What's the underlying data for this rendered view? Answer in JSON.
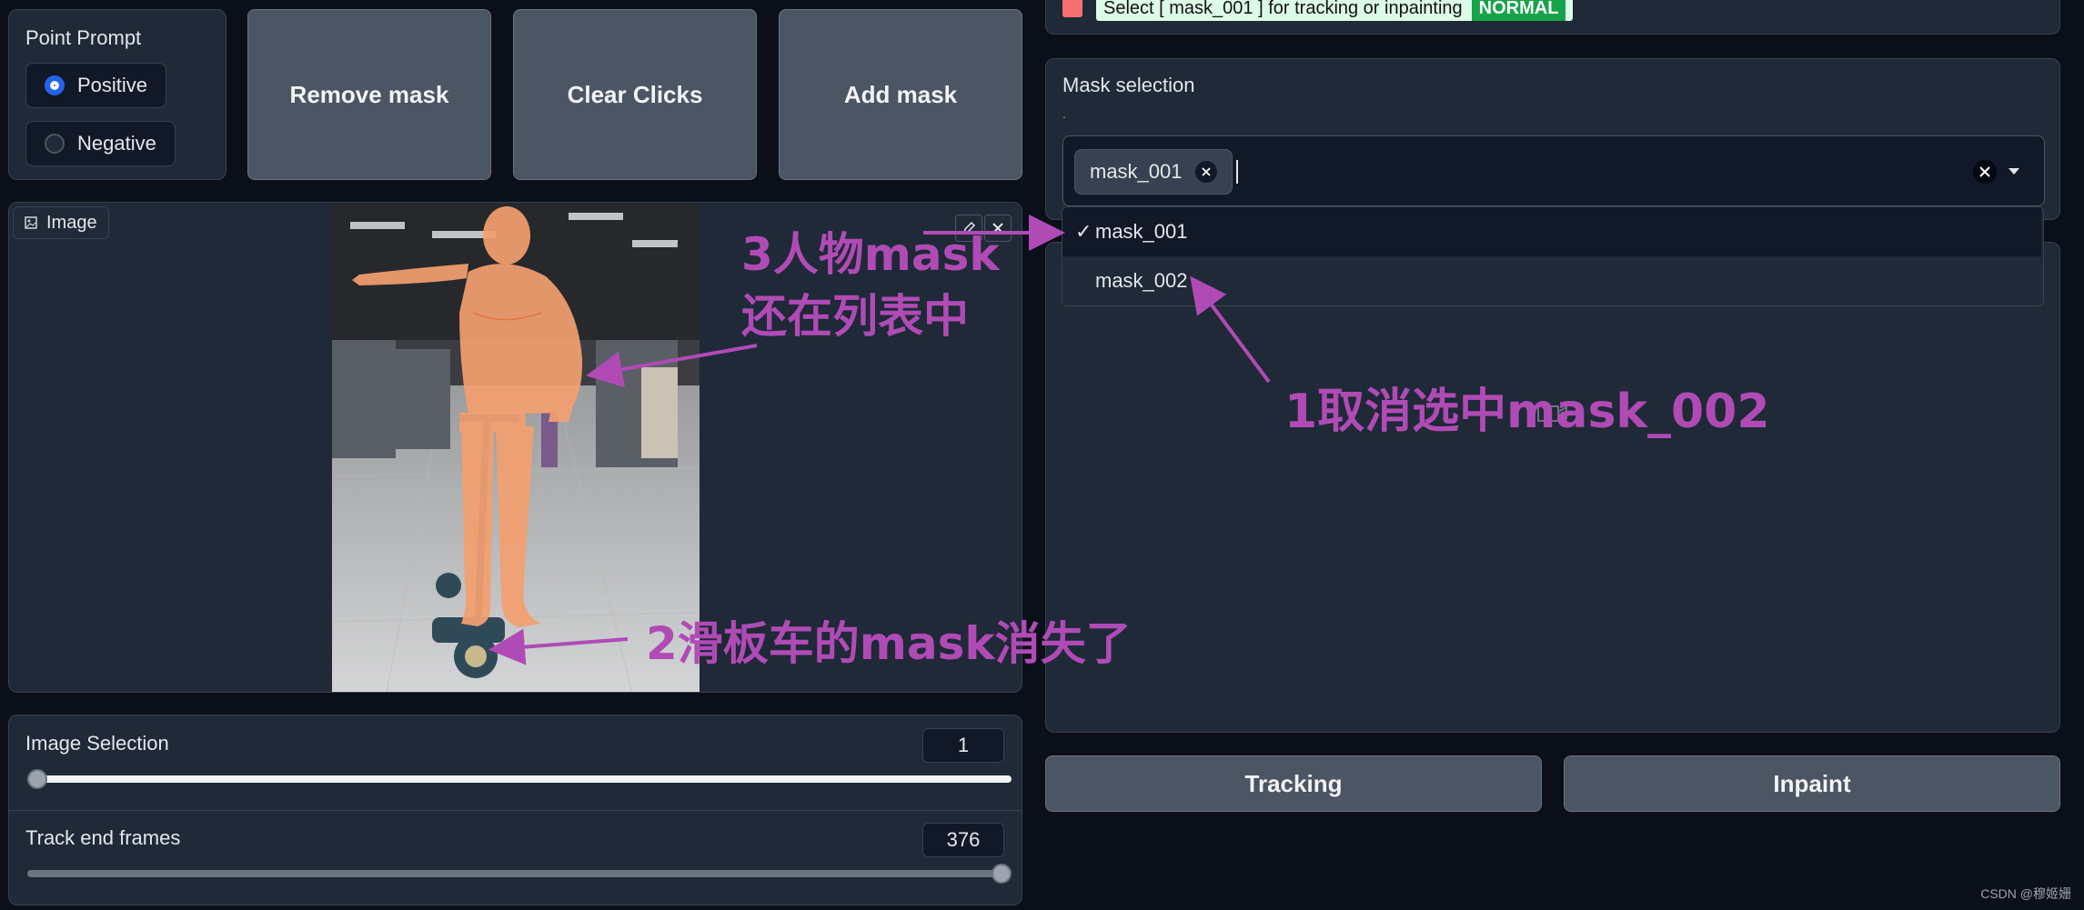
{
  "status": {
    "message": "Select [ mask_001 ] for tracking or inpainting",
    "badge": "NORMAL"
  },
  "point_prompt": {
    "label": "Point Prompt",
    "options": [
      "Positive",
      "Negative"
    ],
    "selected": "Positive"
  },
  "buttons": {
    "remove_mask": "Remove mask",
    "clear_clicks": "Clear Clicks",
    "add_mask": "Add mask",
    "tracking": "Tracking",
    "inpaint": "Inpaint"
  },
  "image_panel": {
    "label": "Image"
  },
  "mask_selection": {
    "label": "Mask selection",
    "hint": ".",
    "chips": [
      "mask_001"
    ],
    "options": [
      {
        "label": "mask_001",
        "checked": true,
        "check": "✓"
      },
      {
        "label": "mask_002",
        "checked": false,
        "check": ""
      }
    ]
  },
  "sliders": {
    "image_selection": {
      "label": "Image Selection",
      "value": "1",
      "fraction": 0.0
    },
    "track_end_frames": {
      "label": "Track end frames",
      "value": "376",
      "fraction": 1.0
    }
  },
  "annotations": {
    "a1": "1取消选中mask_002",
    "a2": "2滑板车的mask消失了",
    "a3_line1": "3人物mask",
    "a3_line2": "还在列表中"
  },
  "watermark": "CSDN @穆姬姗",
  "colors": {
    "accent": "#2563eb",
    "badge_bg": "#16a34a",
    "annotation": "#b04bb6",
    "mask_overlay": "#f4a070"
  }
}
